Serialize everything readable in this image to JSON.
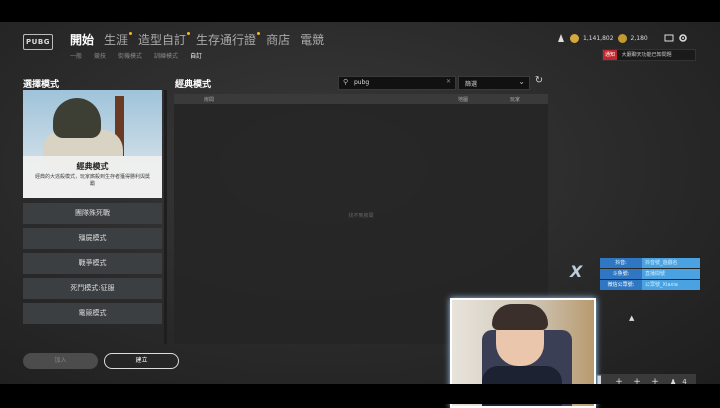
{
  "header": {
    "logo_text": "PUBG",
    "nav": [
      {
        "label": "開始",
        "active": true,
        "dot": false
      },
      {
        "label": "生涯",
        "active": false,
        "dot": true
      },
      {
        "label": "造型自訂",
        "active": false,
        "dot": true
      },
      {
        "label": "生存通行證",
        "active": false,
        "dot": true
      },
      {
        "label": "商店",
        "active": false,
        "dot": false
      },
      {
        "label": "電競",
        "active": false,
        "dot": false
      }
    ],
    "subnav": [
      {
        "label": "一般",
        "active": false
      },
      {
        "label": "競技",
        "active": false
      },
      {
        "label": "街機模式",
        "active": false
      },
      {
        "label": "訓練模式",
        "active": false
      },
      {
        "label": "自訂",
        "active": true
      }
    ],
    "currency_gold": "1,141,802",
    "currency_bp": "2,180",
    "promo_tag": "通知",
    "promo_text": "大廳聊天功能已知問題"
  },
  "left": {
    "title": "選擇模式",
    "hero_title": "經典模式",
    "hero_desc": "經典的大逃殺模式，玩家廝殺到生存者獲得勝利與獎勵",
    "modes": [
      "團隊殊死戰",
      "殭屍模式",
      "戰爭模式",
      "死鬥模式:征服",
      "電競模式"
    ]
  },
  "panel": {
    "title": "經典模式",
    "search_value": "pubg",
    "filter_value": "篩選",
    "columns": [
      "房間",
      "地圖",
      "玩家"
    ],
    "empty_message": "找不到房間"
  },
  "footer": {
    "join_label": "加入",
    "create_label": "建立"
  },
  "stream_overlay": {
    "logo": "X",
    "rows": [
      {
        "label": "抖音:",
        "value": "抖音號_遊戲名"
      },
      {
        "label": "斗魚號:",
        "value": "直播間號"
      },
      {
        "label": "微信公眾號:",
        "value": "公眾號_Xiaxia"
      }
    ]
  },
  "slots": {
    "count": "4"
  }
}
